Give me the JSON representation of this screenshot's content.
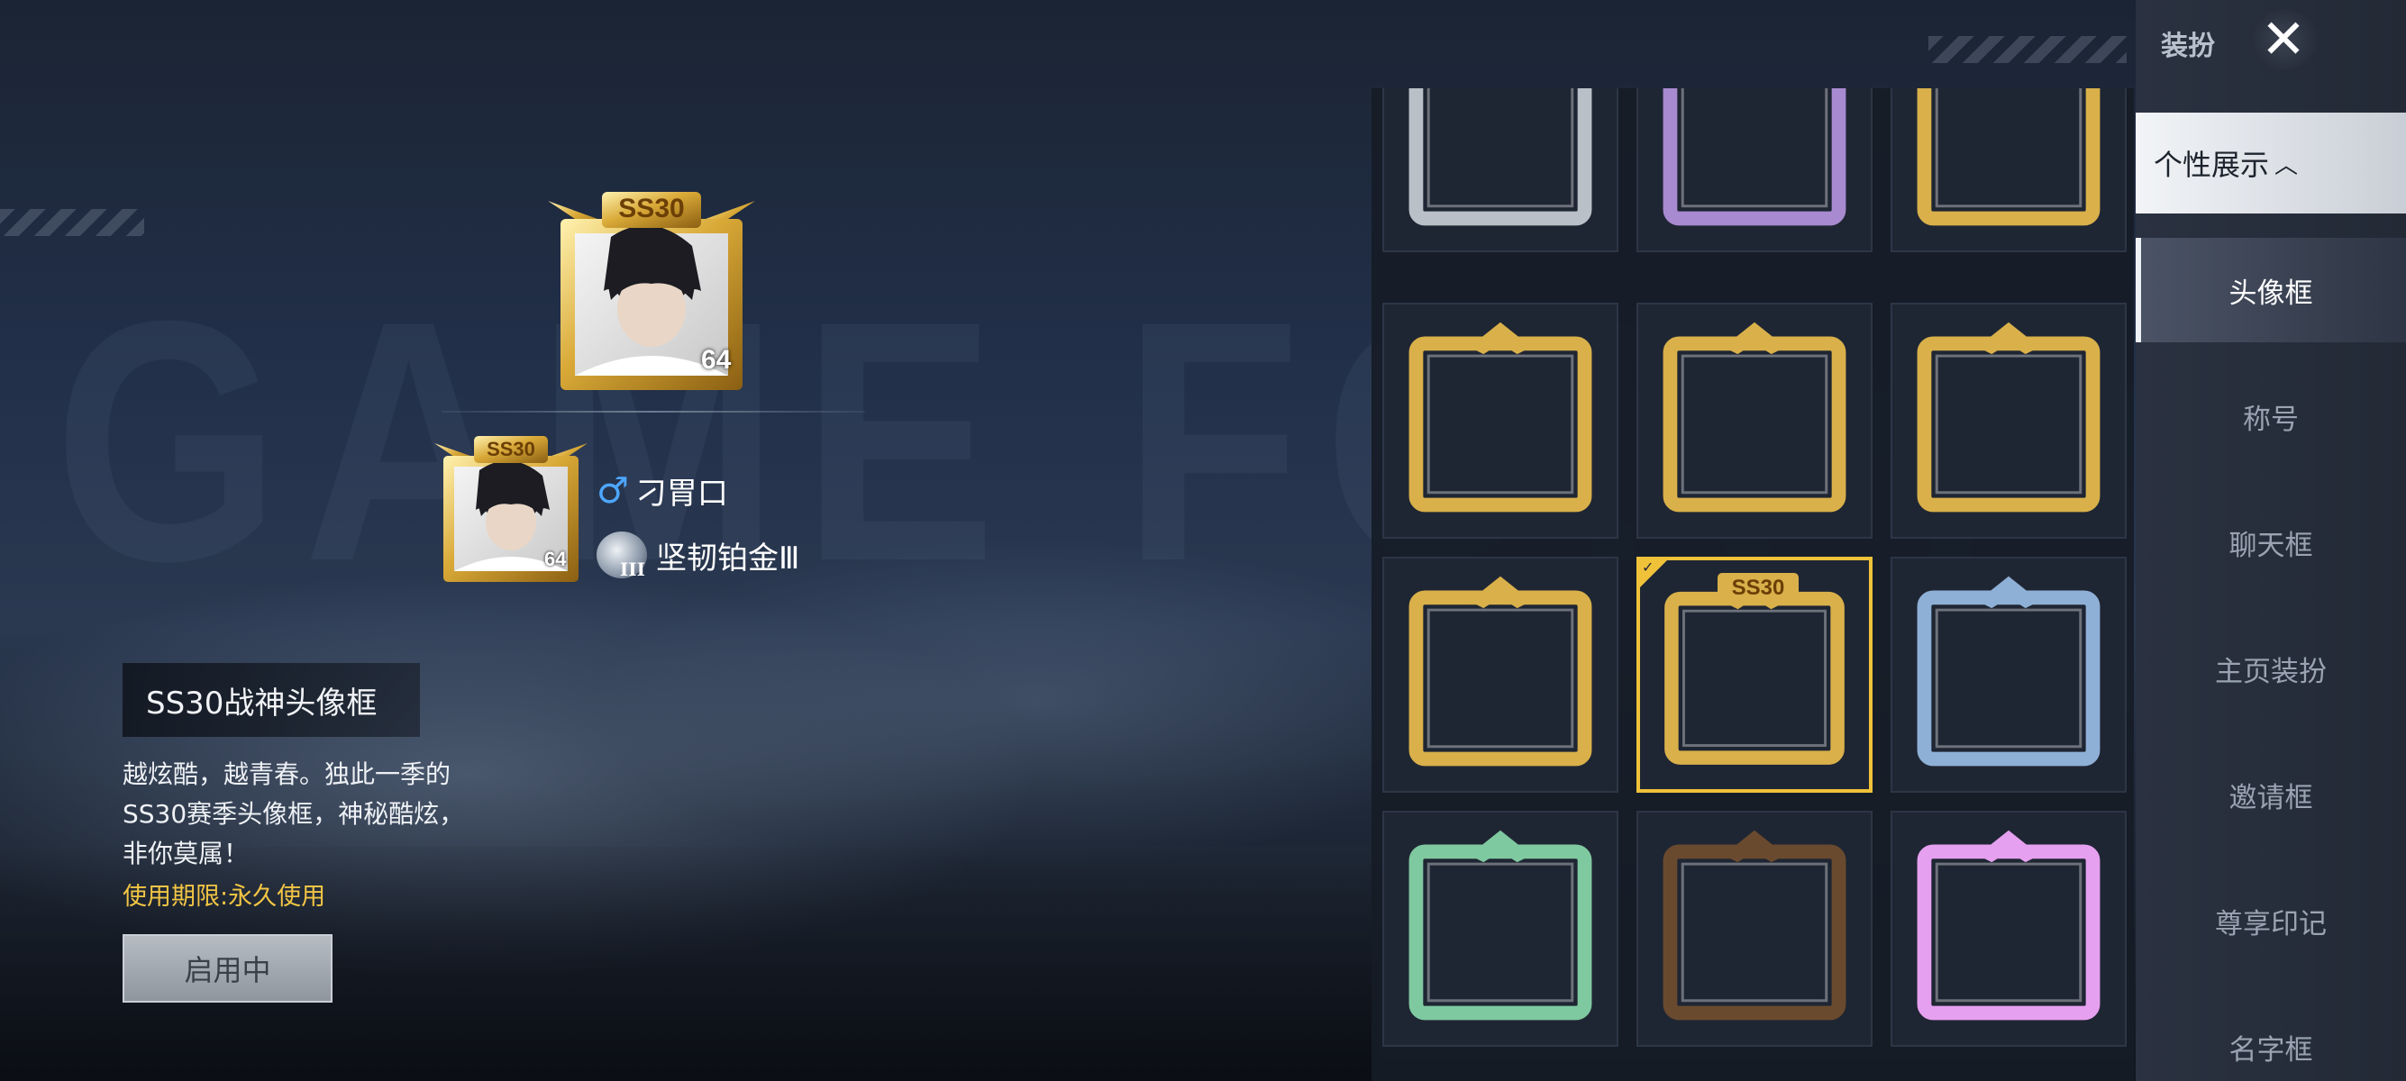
{
  "sidebar": {
    "header_label": "装扮",
    "close_label": "✕",
    "section_label": "个性展示",
    "section_chevron": "︿",
    "items": [
      {
        "label": "头像框"
      },
      {
        "label": "称号"
      },
      {
        "label": "聊天框"
      },
      {
        "label": "主页装扮"
      },
      {
        "label": "邀请框"
      },
      {
        "label": "尊享印记"
      },
      {
        "label": "名字框"
      }
    ]
  },
  "preview": {
    "frame_badge": "SS30",
    "level": "64",
    "player_name": "刁胃口",
    "gender_symbol": "♂",
    "rank": "坚韧铂金Ⅲ",
    "rank_tier": "III"
  },
  "item": {
    "title": "SS30战神头像框",
    "description": "越炫酷，越青春。独此一季的SS30赛季头像框，神秘酷炫，非你莫属！",
    "expiry": "使用期限:永久使用",
    "button_label": "启用中"
  },
  "grid": {
    "frames": [
      {
        "name": "silver-frame",
        "style": "silver"
      },
      {
        "name": "purple-frame",
        "style": "purple"
      },
      {
        "name": "gold-frame",
        "style": "gold"
      },
      {
        "name": "gold-star-frame",
        "style": "gold"
      },
      {
        "name": "gold-crown-frame",
        "style": "gold"
      },
      {
        "name": "gold-wing-frame",
        "style": "gold"
      },
      {
        "name": "gold-wing-frame-2",
        "style": "gold"
      },
      {
        "name": "ss30-frame",
        "style": "gold",
        "badge": "SS30",
        "selected": true
      },
      {
        "name": "dog-bow-frame",
        "style": "blue"
      },
      {
        "name": "floral-frame",
        "style": "green"
      },
      {
        "name": "forest-frame",
        "style": "wood"
      },
      {
        "name": "neon-pink-frame",
        "style": "pink"
      }
    ],
    "colors": {
      "silver": "#b9c0c8",
      "purple": "#a88ad0",
      "gold": "#d9b04a",
      "blue": "#8fb0d6",
      "green": "#7fc9a0",
      "wood": "#6a4a2e",
      "pink": "#e6a0f0",
      "selected": "#f0c23a"
    }
  },
  "watermark": "GAME FOR PEACE"
}
